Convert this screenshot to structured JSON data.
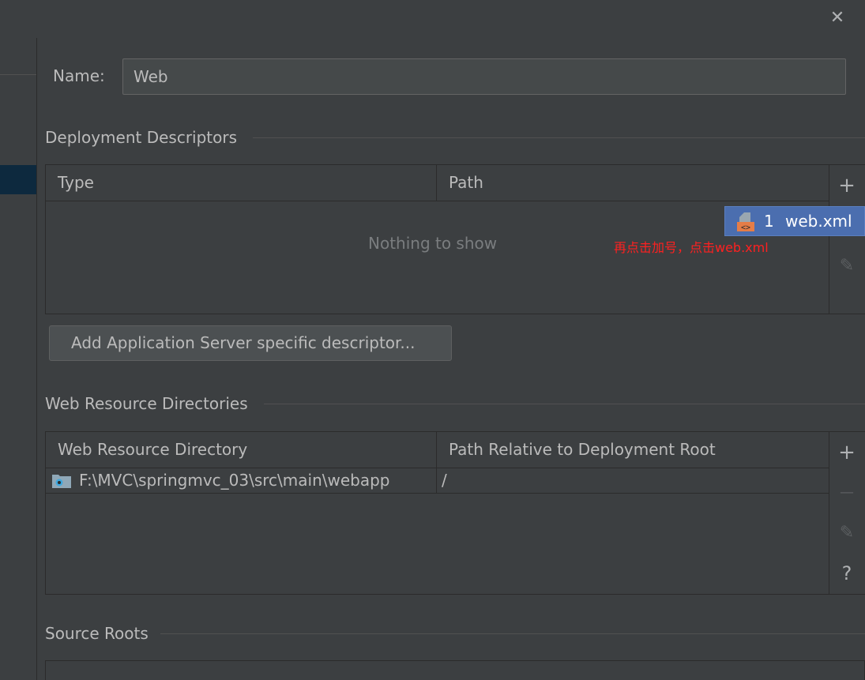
{
  "dialog": {
    "close_icon": "close-icon"
  },
  "name_field": {
    "label": "Name:",
    "value": "Web"
  },
  "deployment": {
    "title": "Deployment Descriptors",
    "columns": [
      "Type",
      "Path"
    ],
    "empty_text": "Nothing to show",
    "annotation": "再点击加号，点击web.xml",
    "popup_item": {
      "index": "1",
      "label": "web.xml",
      "icon": "xml-file-icon"
    },
    "button_label": "Add Application Server specific descriptor..."
  },
  "web_resources": {
    "title": "Web Resource Directories",
    "columns": [
      "Web Resource Directory",
      "Path Relative to Deployment Root"
    ],
    "rows": [
      {
        "directory": "F:\\MVC\\springmvc_03\\src\\main\\webapp",
        "path": "/",
        "icon": "web-folder-icon"
      }
    ]
  },
  "source_roots": {
    "title": "Source Roots"
  },
  "toolbar_icons": {
    "add": "+",
    "remove": "—",
    "help": "?"
  },
  "colors": {
    "background": "#3c3f41",
    "selection": "#4b6eaf",
    "annotation": "#ff2020"
  }
}
